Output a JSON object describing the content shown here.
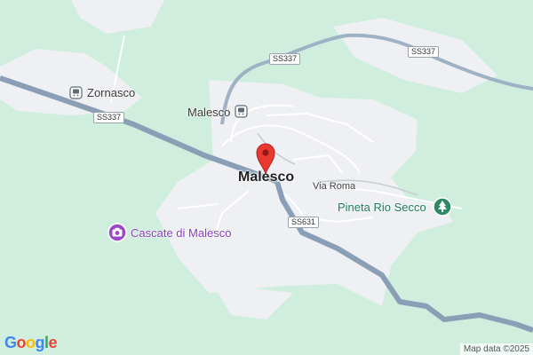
{
  "map": {
    "town_label": "Malesco",
    "places": {
      "zornasco": "Zornasco",
      "malesco_station": "Malesco"
    },
    "streets": {
      "via_roma": "Via Roma"
    },
    "road_shields": {
      "ss337_top": "SS337",
      "ss337_right": "SS337",
      "ss337_left": "SS337",
      "ss631": "SS631"
    },
    "pois": {
      "pineta": "Pineta Rio Secco",
      "cascate": "Cascate di Malesco"
    },
    "colors": {
      "forest": "#cfeedd",
      "urban": "#eef0f3",
      "highway": "#8a9fb5",
      "marker": "#e8382f",
      "poi_green": "#1e7d57",
      "poi_purple": "#8a3fbf"
    },
    "icons": {
      "marker": "map-pin-icon",
      "station": "train-station-icon",
      "park": "tree-icon",
      "attraction": "camera-icon"
    }
  },
  "footer": {
    "attribution": "Map data ©2025",
    "logo_text": "Google"
  }
}
